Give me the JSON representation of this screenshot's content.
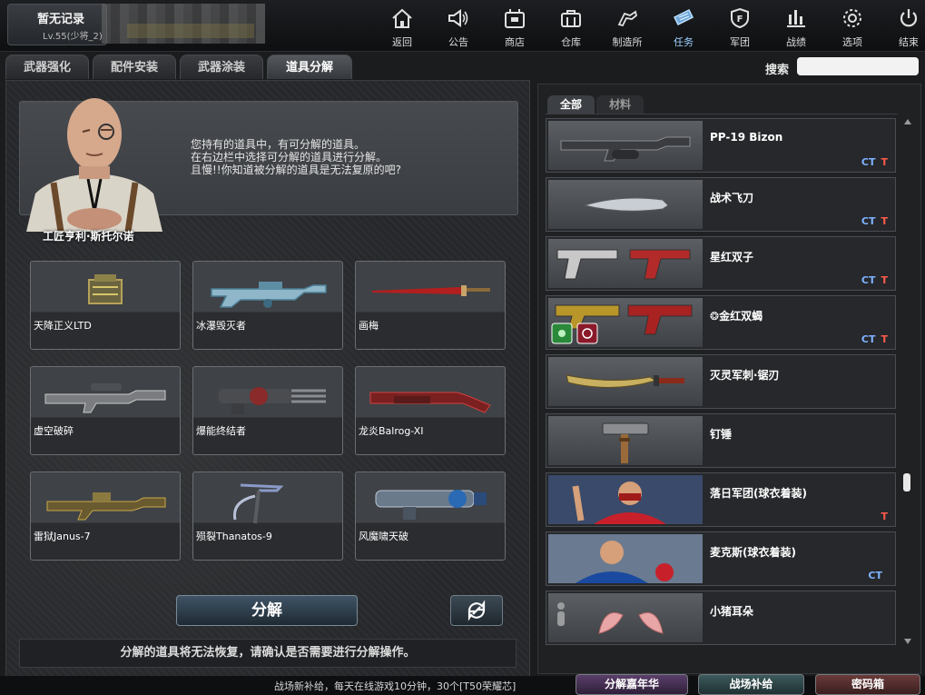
{
  "profile": {
    "name": "暂无记录",
    "level": "Lv.55(少将_2)"
  },
  "nav": [
    {
      "label": "返回",
      "icon": "home-icon"
    },
    {
      "label": "公告",
      "icon": "megaphone-icon"
    },
    {
      "label": "商店",
      "icon": "shop-icon"
    },
    {
      "label": "仓库",
      "icon": "briefcase-icon"
    },
    {
      "label": "制造所",
      "icon": "crafting-icon"
    },
    {
      "label": "任务",
      "icon": "mission-icon",
      "active": true
    },
    {
      "label": "军团",
      "icon": "shield-icon"
    },
    {
      "label": "战绩",
      "icon": "bar-chart-icon"
    },
    {
      "label": "选项",
      "icon": "gear-icon"
    },
    {
      "label": "结束",
      "icon": "power-icon"
    }
  ],
  "tabs": [
    "武器强化",
    "配件安装",
    "武器涂装",
    "道具分解"
  ],
  "active_tab": "道具分解",
  "search": {
    "label": "搜索",
    "placeholder": ""
  },
  "npc": {
    "name": "工匠亨利·斯托尔诺",
    "lines": [
      "您持有的道具中，有可分解的道具。",
      "在右边栏中选择可分解的道具进行分解。",
      "且慢!!你知道被分解的道具是无法复原的吧?"
    ]
  },
  "grid_items": [
    {
      "name": "天降正义LTD",
      "icon": "supply-crate-icon"
    },
    {
      "name": "冰瀑毁灭者",
      "icon": "machine-gun-icon"
    },
    {
      "name": "画梅",
      "icon": "red-sword-icon"
    },
    {
      "name": "虚空破碎",
      "icon": "sniper-rifle-icon"
    },
    {
      "name": "爆能终结者",
      "icon": "gatling-gun-icon"
    },
    {
      "name": "龙炎Balrog-XI",
      "icon": "shotgun-icon"
    },
    {
      "name": "雷狱Janus-7",
      "icon": "lmg-icon"
    },
    {
      "name": "殒裂Thanatos-9",
      "icon": "scythe-icon"
    },
    {
      "name": "风魔啸天破",
      "icon": "launcher-icon"
    }
  ],
  "decompose_button": "分解",
  "warning": "分解的道具将无法恢复，请确认是否需要进行分解操作。",
  "right_tabs": [
    "全部",
    "材料"
  ],
  "list": [
    {
      "name": "PP-19 Bizon",
      "icon": "smg-icon",
      "ct": "CT",
      "t": "T"
    },
    {
      "name": "战术飞刀",
      "icon": "throwing-knife-icon",
      "ct": "CT",
      "t": "T"
    },
    {
      "name": "星红双子",
      "icon": "dual-pistols-icon",
      "ct": "CT",
      "t": "T"
    },
    {
      "name": "金红双蝎",
      "prefix": "❂",
      "icon": "gold-dual-pistols-icon",
      "ct": "CT",
      "t": "T"
    },
    {
      "name": "灭灵军刺·锯刃",
      "icon": "combat-knife-icon",
      "ct": "",
      "t": ""
    },
    {
      "name": "钉锤",
      "icon": "hammer-icon",
      "ct": "",
      "t": ""
    },
    {
      "name": "落日军团(球衣着装)",
      "icon": "character-red-icon",
      "ct": "",
      "t": "T"
    },
    {
      "name": "麦克斯(球衣着装)",
      "icon": "character-blue-icon",
      "ct": "CT",
      "t": ""
    },
    {
      "name": "小猪耳朵",
      "icon": "pig-ears-icon",
      "ct": "",
      "t": ""
    }
  ],
  "bottom": {
    "supply_text": "战场新补给，每天在线游戏10分钟，30个[T50荣耀芯]",
    "buttons": [
      "分解嘉年华",
      "战场补给",
      "密码箱"
    ]
  },
  "colors": {
    "ct_tag": "#7fb2ff",
    "t_tag": "#ff5a4a",
    "active_nav": "#9fd2ff"
  }
}
